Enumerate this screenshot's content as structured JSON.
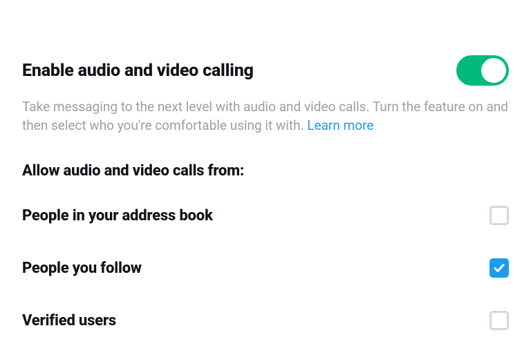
{
  "enable": {
    "title": "Enable audio and video calling",
    "description_prefix": "Take messaging to the next level with audio and video calls. Turn the feature on and then select who you're comfortable using it with. ",
    "learn_more": "Learn more",
    "toggle_on": true
  },
  "allow_from": {
    "subtitle": "Allow audio and video calls from:",
    "options": [
      {
        "label": "People in your address book",
        "checked": false
      },
      {
        "label": "People you follow",
        "checked": true
      },
      {
        "label": "Verified users",
        "checked": false
      }
    ]
  },
  "colors": {
    "accent_toggle": "#00ba7c",
    "accent_check": "#1d9bf0",
    "link": "#1d9bf0"
  }
}
